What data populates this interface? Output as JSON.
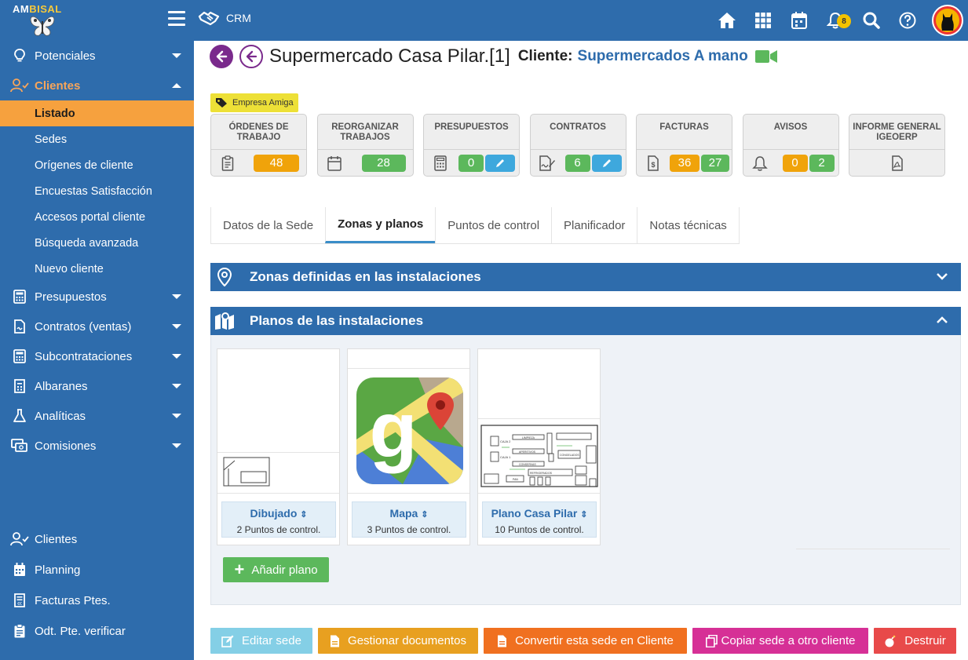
{
  "app": {
    "logo_main": "AM",
    "logo_accent": "BISAL",
    "module_label": "CRM",
    "notification_count": "8"
  },
  "sidebar": {
    "items": [
      {
        "label": "Potenciales",
        "icon": "lightbulb-icon"
      },
      {
        "label": "Clientes",
        "icon": "user-check-icon"
      },
      {
        "label": "Presupuestos",
        "icon": "calculator-icon"
      },
      {
        "label": "Contratos (ventas)",
        "icon": "contract-icon"
      },
      {
        "label": "Subcontrataciones",
        "icon": "calculator-icon"
      },
      {
        "label": "Albaranes",
        "icon": "receipt-icon"
      },
      {
        "label": "Analíticas",
        "icon": "flask-icon"
      },
      {
        "label": "Comisiones",
        "icon": "money-icon"
      }
    ],
    "sub_items": [
      {
        "label": "Listado",
        "selected": true
      },
      {
        "label": "Sedes"
      },
      {
        "label": "Orígenes de cliente"
      },
      {
        "label": "Encuestas Satisfacción"
      },
      {
        "label": "Accesos portal cliente"
      },
      {
        "label": "Búsqueda avanzada"
      },
      {
        "label": "Nuevo cliente"
      }
    ],
    "shortcuts": [
      {
        "label": "Clientes",
        "icon": "user-check-icon"
      },
      {
        "label": "Planning",
        "icon": "calendar-icon"
      },
      {
        "label": "Facturas Ptes.",
        "icon": "invoice-icon"
      },
      {
        "label": "Odt. Pte. verificar",
        "icon": "clipboard-icon"
      }
    ]
  },
  "header": {
    "title": "Supermercado Casa Pilar.[1]",
    "client_label": "Cliente:",
    "client_name": "Supermercados A mano"
  },
  "tag": {
    "label": "Empresa Amiga"
  },
  "cards": [
    {
      "title": "ÓRDENES DE TRABAJO",
      "icon": "clipboard-icon",
      "values": [
        "48"
      ]
    },
    {
      "title": "REORGANIZAR TRABAJOS",
      "icon": "calendar-icon",
      "values": [
        "28"
      ]
    },
    {
      "title": "PRESUPUESTOS",
      "icon": "calculator-icon",
      "values": [
        "0"
      ]
    },
    {
      "title": "CONTRATOS",
      "icon": "contract-sign-icon",
      "values": [
        "6"
      ]
    },
    {
      "title": "FACTURAS",
      "icon": "invoice-dollar-icon",
      "values": [
        "36",
        "27"
      ]
    },
    {
      "title": "AVISOS",
      "icon": "bell-icon",
      "values": [
        "0",
        "2"
      ]
    },
    {
      "title": "INFORME GENERAL IGEOERP",
      "icon": "pdf-icon",
      "values": []
    }
  ],
  "tabs": [
    {
      "label": "Datos de la Sede"
    },
    {
      "label": "Zonas y planos",
      "active": true
    },
    {
      "label": "Puntos de control"
    },
    {
      "label": "Planificador"
    },
    {
      "label": "Notas técnicas"
    }
  ],
  "panels": {
    "zones_title": "Zonas definidas en las instalaciones",
    "plans_title": "Planos de las instalaciones"
  },
  "plans": [
    {
      "name": "Dibujado",
      "count": "2 Puntos de control."
    },
    {
      "name": "Mapa",
      "count": "3 Puntos de control."
    },
    {
      "name": "Plano Casa Pilar",
      "count": "10 Puntos de control."
    }
  ],
  "add_plan_label": "Añadir plano",
  "floorplan_labels": [
    "CAJA 2",
    "CAJA 1",
    "LIMPIEZA",
    "APERITIVOS",
    "CONSERVAS",
    "CONGELADOS",
    "REFRIGERADOS",
    "PAN"
  ],
  "actions": [
    {
      "label": "Editar sede",
      "color": "#5bc0de"
    },
    {
      "label": "Gestionar documentos",
      "color": "#e8a020"
    },
    {
      "label": "Convertir esta sede en Cliente",
      "color": "#f07020"
    },
    {
      "label": "Copiar sede a otro cliente",
      "color": "#d63096"
    },
    {
      "label": "Destruir",
      "color": "#e84a4a"
    }
  ],
  "colors": {
    "primary": "#2e6cac",
    "selected_menu": "#f6a13e",
    "back_button": "#7a2a8c",
    "tag": "#ede037"
  }
}
